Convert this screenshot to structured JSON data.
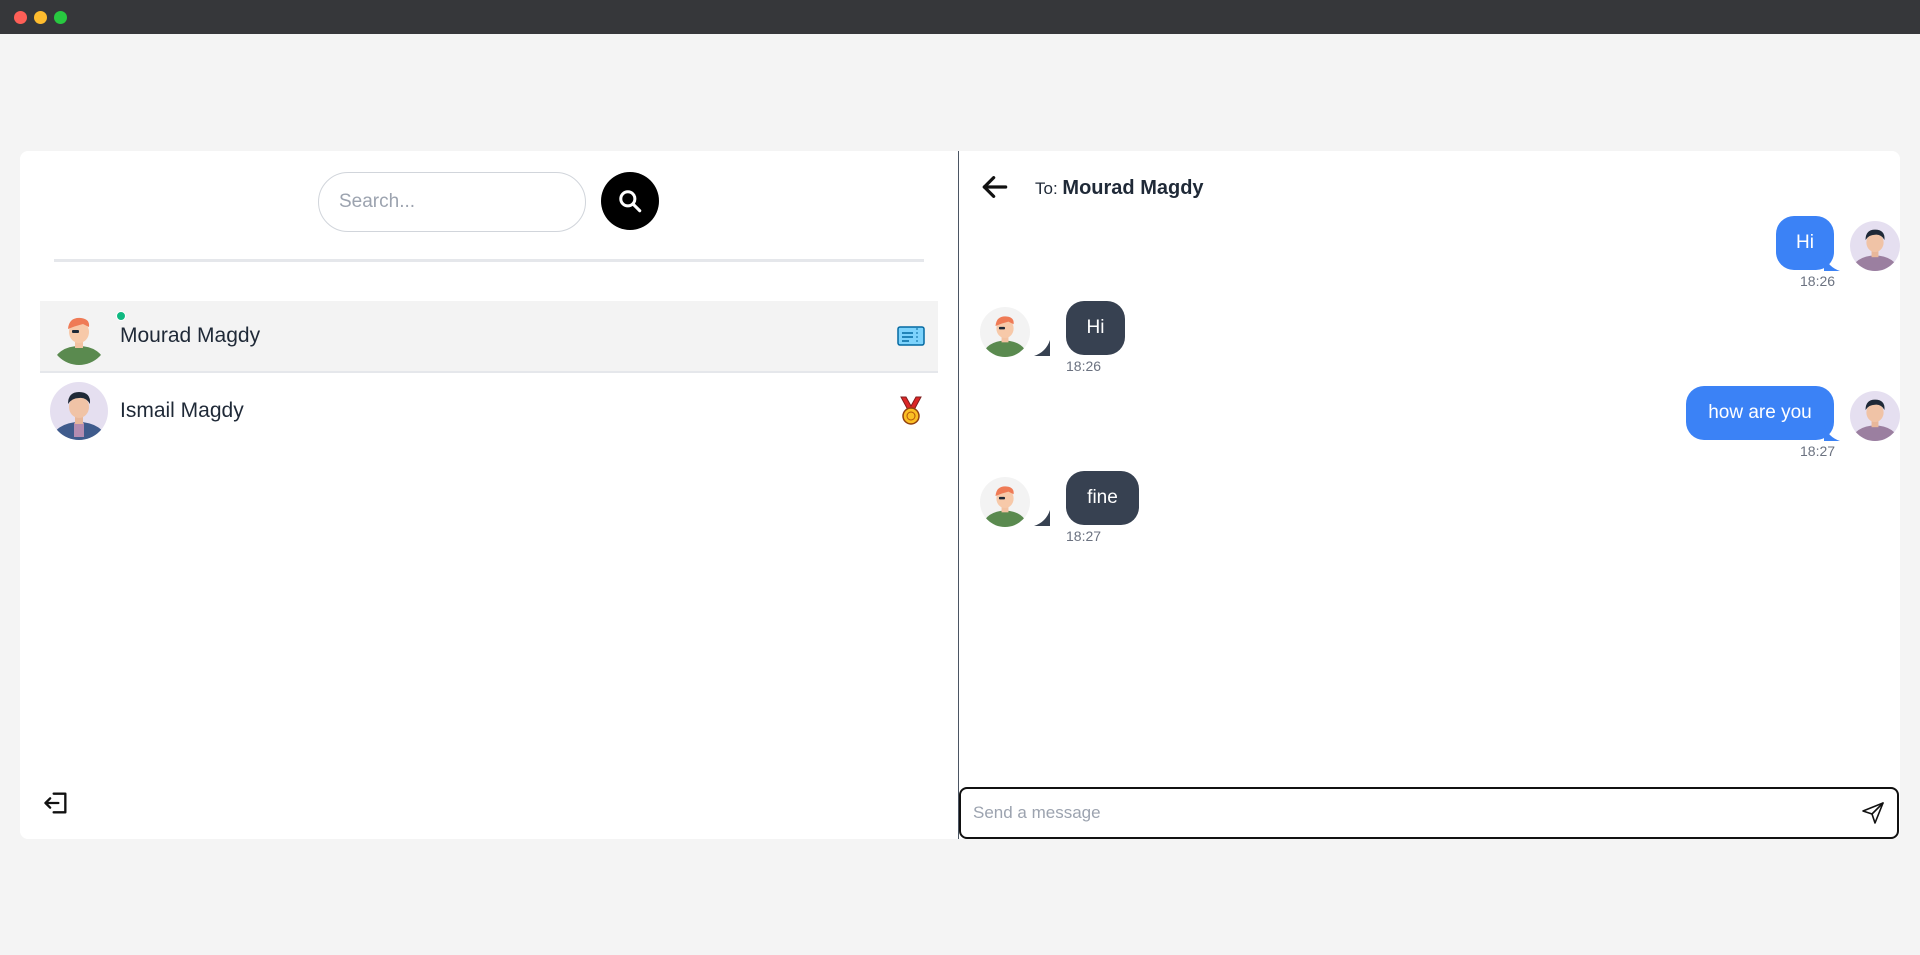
{
  "search": {
    "placeholder": "Search..."
  },
  "contacts": [
    {
      "name": "Mourad Magdy",
      "online": true,
      "badge_icon": "ticket-icon"
    },
    {
      "name": "Ismail Magdy",
      "online": false,
      "badge_icon": "medal-icon"
    }
  ],
  "chat": {
    "to_prefix": "To:",
    "to_name": "Mourad Magdy",
    "messages": [
      {
        "direction": "outgoing",
        "text": "Hi",
        "time": "18:26"
      },
      {
        "direction": "incoming",
        "text": "Hi",
        "time": "18:26"
      },
      {
        "direction": "outgoing",
        "text": "how are you",
        "time": "18:27"
      },
      {
        "direction": "incoming",
        "text": "fine",
        "time": "18:27"
      }
    ]
  },
  "composer": {
    "placeholder": "Send a message"
  },
  "colors": {
    "outgoing_bubble": "#3b82f6",
    "incoming_bubble": "#374151",
    "online_dot": "#10b981",
    "search_button": "#000000"
  }
}
